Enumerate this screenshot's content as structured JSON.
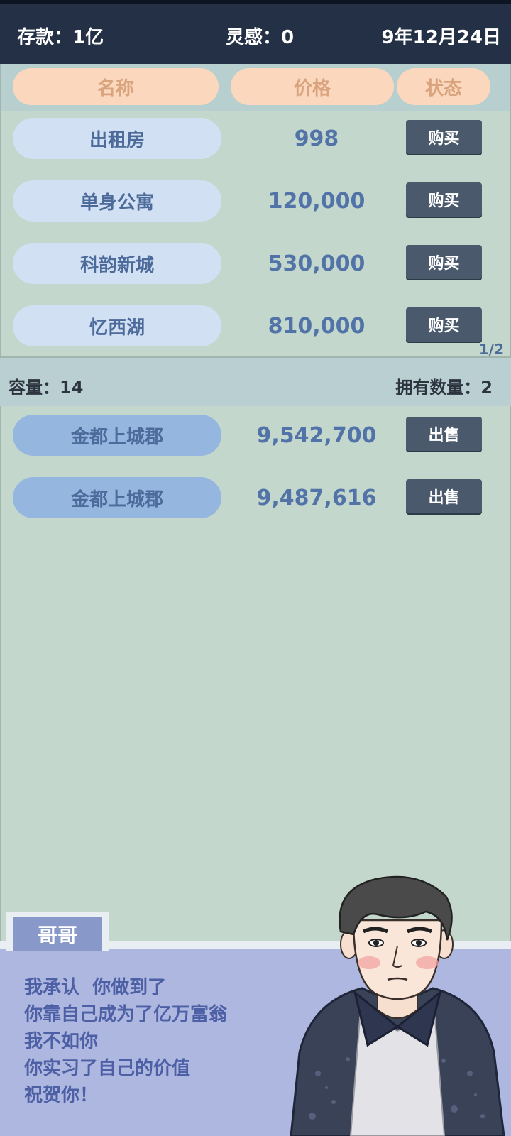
{
  "status": {
    "deposit": "存款：1亿",
    "inspiration": "灵感：0",
    "date": "9年12月24日"
  },
  "market": {
    "headers": {
      "name": "名称",
      "price": "价格",
      "status": "状态"
    },
    "items": [
      {
        "name": "出租房",
        "price": "998",
        "action": "购买"
      },
      {
        "name": "单身公寓",
        "price": "120,000",
        "action": "购买"
      },
      {
        "name": "科韵新城",
        "price": "530,000",
        "action": "购买"
      },
      {
        "name": "忆西湖",
        "price": "810,000",
        "action": "购买"
      }
    ],
    "page": "1/2"
  },
  "owned": {
    "capacity": "容量：14",
    "count": "拥有数量：2",
    "items": [
      {
        "name": "金都上城郡",
        "price": "9,542,700",
        "action": "出售"
      },
      {
        "name": "金都上城郡",
        "price": "9,487,616",
        "action": "出售"
      }
    ]
  },
  "dialogue": {
    "speaker": "哥哥",
    "lines": [
      "我承认  你做到了",
      "你靠自己成为了亿万富翁",
      "我不如你",
      "你实习了自己的价值",
      "祝贺你！"
    ]
  },
  "colors": {
    "topbar": "#243045",
    "background": "#c3d7cc",
    "header_pill": "#fbd7bd",
    "market_pill": "#d2e0f3",
    "owned_pill": "#95b6df",
    "button": "#4a5a6c",
    "dialog": "#aeb7df"
  }
}
